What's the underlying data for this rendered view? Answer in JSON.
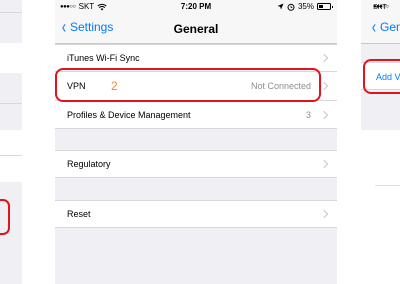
{
  "status_bar": {
    "carrier": "SKT",
    "time": "7:20 PM",
    "battery": "35%"
  },
  "nav": {
    "back_label": "Settings",
    "title": "General"
  },
  "cells": {
    "itunes_wifi_sync": "iTunes Wi-Fi Sync",
    "vpn": "VPN",
    "vpn_status": "Not Connected",
    "profiles": "Profiles & Device Management",
    "profiles_count": "3",
    "regulatory": "Regulatory",
    "reset": "Reset"
  },
  "annotation": {
    "step_number": "2",
    "highlight_color": "#e3131b",
    "step_color": "#f08a2c"
  },
  "right_screen": {
    "carrier": "SKT",
    "back_label": "Gen",
    "add_label": "Add V"
  },
  "colors": {
    "accent": "#007aff",
    "background": "#efeff4"
  }
}
